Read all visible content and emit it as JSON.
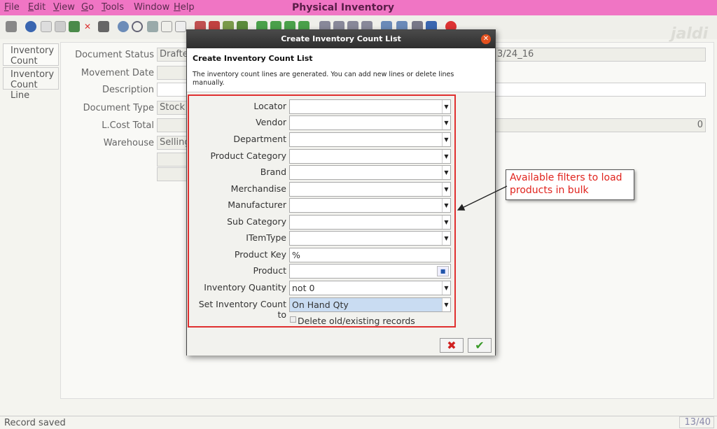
{
  "app": {
    "title": "Physical Inventory",
    "menu": [
      {
        "prefix": "",
        "accel": "F",
        "rest": "ile"
      },
      {
        "prefix": "",
        "accel": "E",
        "rest": "dit"
      },
      {
        "prefix": "",
        "accel": "V",
        "rest": "iew"
      },
      {
        "prefix": "",
        "accel": "G",
        "rest": "o"
      },
      {
        "prefix": "",
        "accel": "T",
        "rest": "ools"
      },
      {
        "prefix": "",
        "accel": "",
        "rest": "Window"
      },
      {
        "prefix": "",
        "accel": "H",
        "rest": "elp"
      }
    ],
    "logo": "jaldi",
    "colors": {
      "menubar": "#f075c4",
      "callout_text": "#e0231d",
      "highlight": "#e03030"
    }
  },
  "tabs": [
    "Inventory Count",
    "Inventory Count Line"
  ],
  "form": {
    "fields": [
      {
        "label": "Document Status",
        "value": "Drafted"
      },
      {
        "label": "Movement Date",
        "value": ""
      },
      {
        "label": "Description",
        "value": ""
      },
      {
        "label": "Document Type",
        "value": "Stock U"
      },
      {
        "label": "L.Cost Total",
        "value": ""
      },
      {
        "label": "Warehouse",
        "value": "Selling"
      }
    ],
    "right_date": "3/24_16",
    "right_total": "0"
  },
  "dialog": {
    "title": "Create Inventory Count List",
    "heading": "Create Inventory Count List",
    "info": "The inventory count lines are generated. You can add new lines or delete lines manually.",
    "filters": [
      {
        "label": "Locator",
        "value": ""
      },
      {
        "label": "Vendor",
        "value": ""
      },
      {
        "label": "Department",
        "value": ""
      },
      {
        "label": "Product Category",
        "value": ""
      },
      {
        "label": "Brand",
        "value": ""
      },
      {
        "label": "Merchandise",
        "value": ""
      },
      {
        "label": "Manufacturer",
        "value": ""
      },
      {
        "label": "Sub Category",
        "value": ""
      },
      {
        "label": "ITemType",
        "value": ""
      },
      {
        "label": "Product Key",
        "value": "%"
      },
      {
        "label": "Product",
        "value": ""
      },
      {
        "label": "Inventory Quantity",
        "value": "not 0"
      },
      {
        "label": "Set Inventory Count to",
        "value": "On Hand Qty"
      }
    ],
    "delete_label": "Delete old/existing records"
  },
  "callout": "Available filters to load products in bulk",
  "status": {
    "text": "Record saved",
    "counter": "13/40"
  }
}
